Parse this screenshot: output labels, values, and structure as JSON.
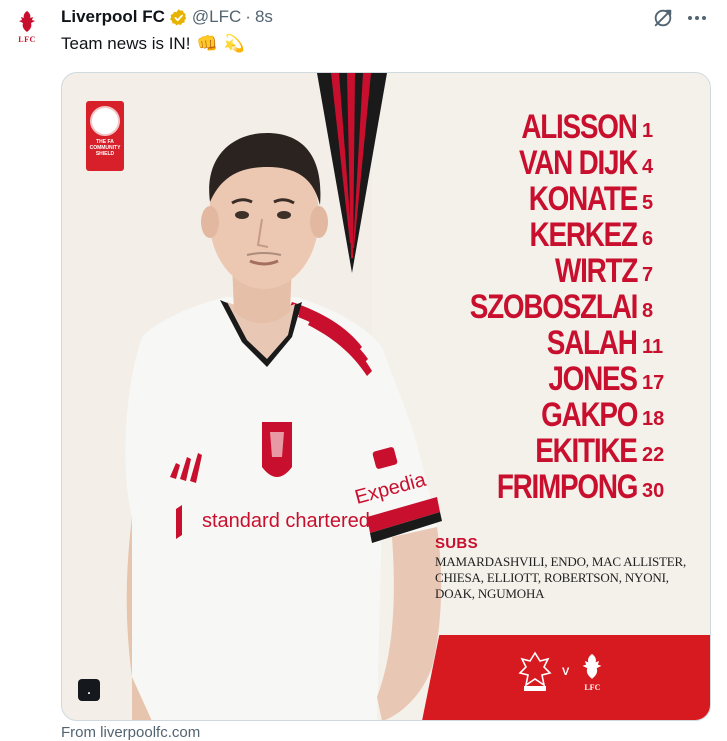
{
  "author": {
    "name": "Liverpool FC",
    "handle": "@LFC",
    "separator": "·",
    "time": "8s",
    "avatar_text": "LFC",
    "verified_color": "#e8b200"
  },
  "tweet": {
    "text": "Team news is IN!",
    "emojis": [
      "👊",
      "💫"
    ]
  },
  "media": {
    "badge_text": "THE FA COMMUNITY SHIELD",
    "lineup": [
      {
        "name": "ALISSON",
        "number": "1"
      },
      {
        "name": "VAN DIJK",
        "number": "4"
      },
      {
        "name": "KONATE",
        "number": "5"
      },
      {
        "name": "KERKEZ",
        "number": "6"
      },
      {
        "name": "WIRTZ",
        "number": "7"
      },
      {
        "name": "SZOBOSZLAI",
        "number": "8"
      },
      {
        "name": "SALAH",
        "number": "11"
      },
      {
        "name": "JONES",
        "number": "17"
      },
      {
        "name": "GAKPO",
        "number": "18"
      },
      {
        "name": "EKITIKE",
        "number": "22"
      },
      {
        "name": "FRIMPONG",
        "number": "30"
      }
    ],
    "subs_title": "SUBS",
    "subs_list": "MAMARDASHVILI, ENDO, MAC ALLISTER, CHIESA, ELLIOTT, ROBERTSON, NYONI, DOAK, NGUMOHA",
    "versus": "V",
    "away_crest_text": "LFC",
    "alt_button": ".",
    "jersey_sponsor": "standard chartered",
    "sleeve_sponsor": "Expedia",
    "accent_color": "#c8102e"
  },
  "source": "From liverpoolfc.com"
}
